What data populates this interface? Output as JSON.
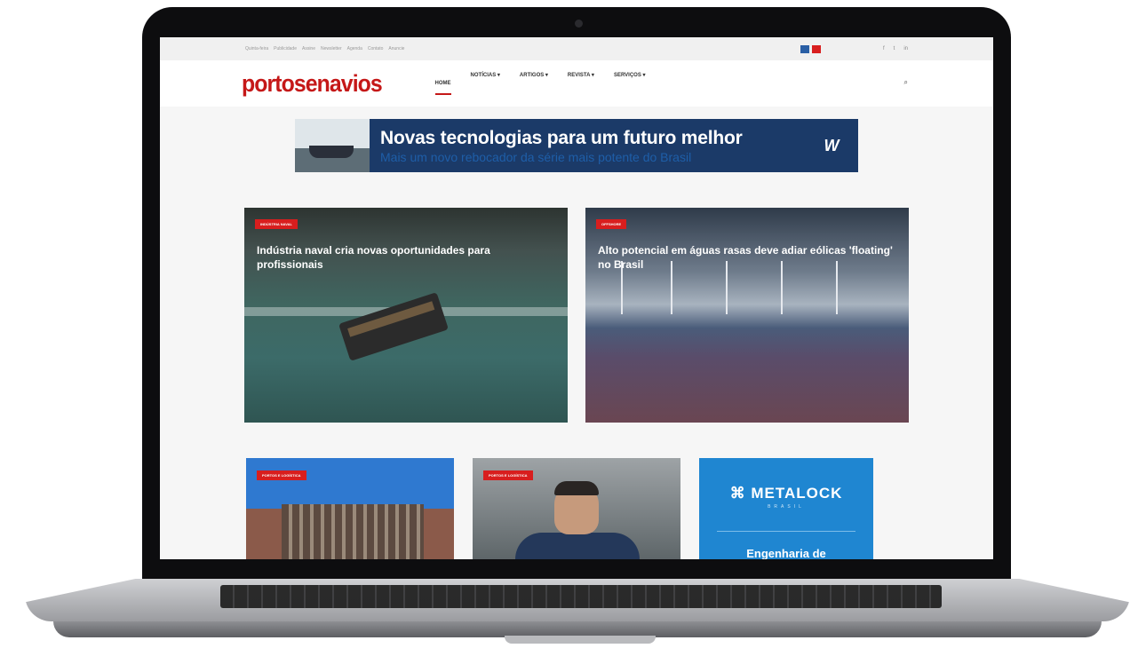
{
  "topbar": {
    "links": [
      "Quinta-feira",
      "Publicidade",
      "Assine",
      "Newsletter",
      "Agenda",
      "Contato",
      "Anuncie"
    ],
    "social": [
      "f",
      "t",
      "in"
    ],
    "accent_colors": [
      "#2a5fa5",
      "#d81e1e"
    ]
  },
  "header": {
    "logo": "portosenavios",
    "menu": [
      {
        "label": "HOME",
        "active": true
      },
      {
        "label": "NOTÍCIAS ▾",
        "active": false
      },
      {
        "label": "ARTIGOS ▾",
        "active": false
      },
      {
        "label": "REVISTA ▾",
        "active": false
      },
      {
        "label": "SERVIÇOS ▾",
        "active": false
      }
    ],
    "search_icon": "search-icon"
  },
  "banner": {
    "headline": "Novas tecnologias para um futuro melhor",
    "subheadline": "Mais um novo rebocador da série mais potente do Brasil",
    "brand": "W"
  },
  "hero": [
    {
      "tag": "INDÚSTRIA NAVAL",
      "title": "Indústria naval cria novas oportunidades para profissionais"
    },
    {
      "tag": "OFFSHORE",
      "title": "Alto potencial em águas rasas deve adiar eólicas 'floating' no Brasil"
    }
  ],
  "cards": [
    {
      "tag": "PORTOS E LOGÍSTICA"
    },
    {
      "tag": "PORTOS E LOGÍSTICA"
    },
    {
      "ad_brand": "METALOCK",
      "ad_sub": "BRASIL",
      "ad_text": "Engenharia de"
    }
  ],
  "colors": {
    "brand_red": "#c51818",
    "banner_navy": "#1b3a68",
    "ad_blue": "#1f86d1"
  }
}
